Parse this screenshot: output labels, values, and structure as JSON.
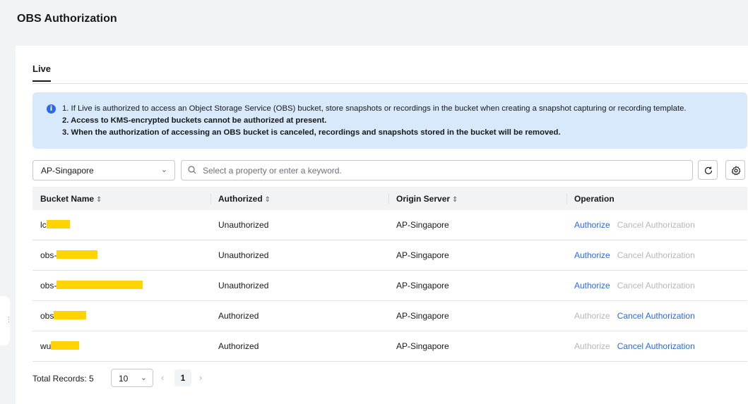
{
  "page": {
    "title": "OBS Authorization"
  },
  "tabs": [
    {
      "label": "Live",
      "active": true
    }
  ],
  "notice": {
    "line1": "1. If Live is authorized to access an Object Storage Service (OBS) bucket, store snapshots or recordings in the bucket when creating a snapshot capturing or recording template.",
    "line2": "2. Access to KMS-encrypted buckets cannot be authorized at present.",
    "line3": "3. When the authorization of accessing an OBS bucket is canceled, recordings and snapshots stored in the bucket will be removed."
  },
  "filter": {
    "region": "AP-Singapore",
    "search_placeholder": "Select a property or enter a keyword."
  },
  "table": {
    "headers": {
      "bucket": "Bucket Name",
      "authorized": "Authorized",
      "origin": "Origin Server",
      "operation": "Operation"
    },
    "rows": [
      {
        "bucket_prefix": "lc",
        "authorized": "Unauthorized",
        "origin": "AP-Singapore",
        "authorize": "Authorize",
        "cancel": "Cancel Authorization",
        "authorize_enabled": true,
        "cancel_enabled": false
      },
      {
        "bucket_prefix": "obs-",
        "authorized": "Unauthorized",
        "origin": "AP-Singapore",
        "authorize": "Authorize",
        "cancel": "Cancel Authorization",
        "authorize_enabled": true,
        "cancel_enabled": false
      },
      {
        "bucket_prefix": "obs-",
        "authorized": "Unauthorized",
        "origin": "AP-Singapore",
        "authorize": "Authorize",
        "cancel": "Cancel Authorization",
        "authorize_enabled": true,
        "cancel_enabled": false
      },
      {
        "bucket_prefix": "obs",
        "authorized": "Authorized",
        "origin": "AP-Singapore",
        "authorize": "Authorize",
        "cancel": "Cancel Authorization",
        "authorize_enabled": false,
        "cancel_enabled": true
      },
      {
        "bucket_prefix": "wu",
        "authorized": "Authorized",
        "origin": "AP-Singapore",
        "authorize": "Authorize",
        "cancel": "Cancel Authorization",
        "authorize_enabled": false,
        "cancel_enabled": true
      }
    ]
  },
  "pager": {
    "total_label": "Total Records: 5",
    "page_size": "10",
    "current_page": "1"
  },
  "colors": {
    "link": "#2a6ae6",
    "disabled": "#b4b7bd",
    "notice_bg": "#d7e9fb",
    "redaction": "#ffd400"
  }
}
